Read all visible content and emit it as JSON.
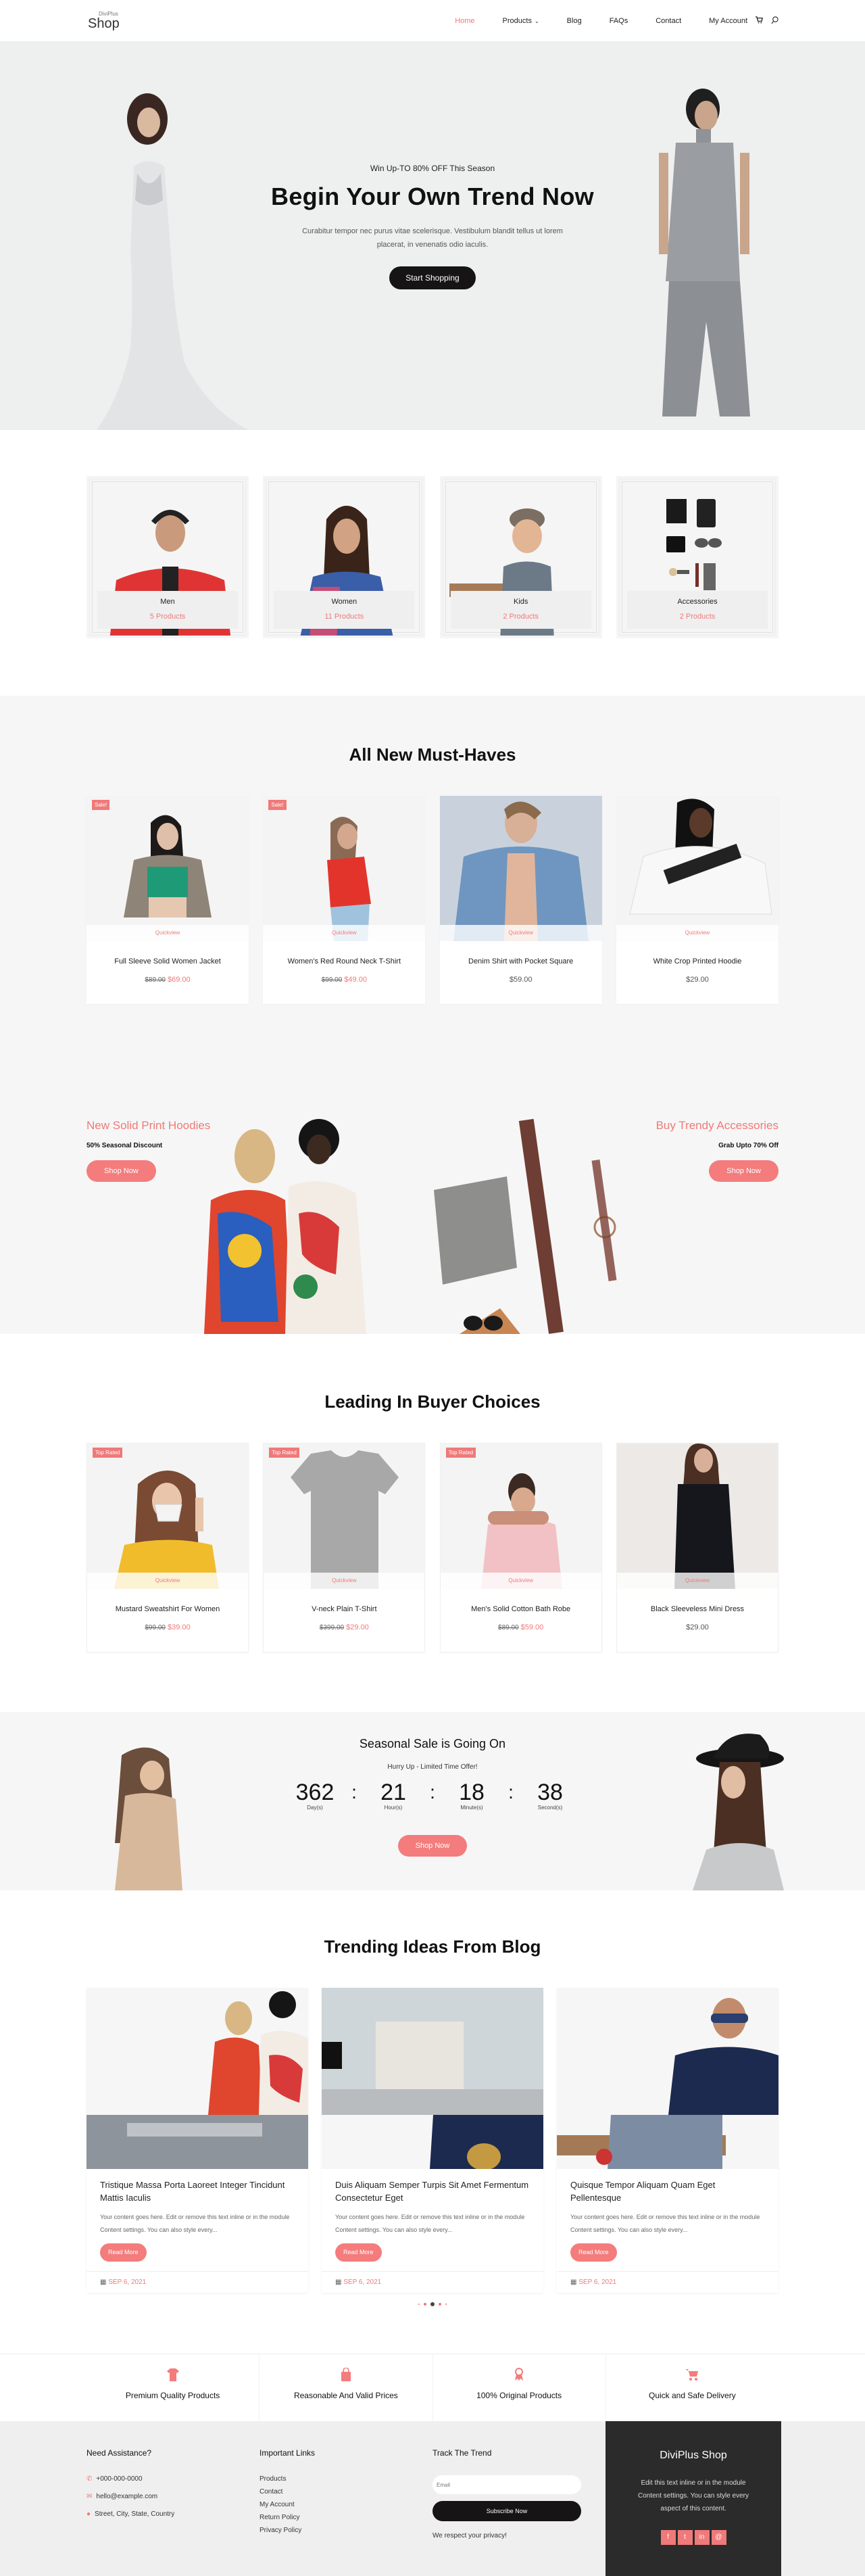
{
  "header": {
    "logo_small": "DiviPlus",
    "logo_big": "Shop",
    "nav": [
      {
        "label": "Home",
        "active": true
      },
      {
        "label": "Products",
        "has_dropdown": true
      },
      {
        "label": "Blog"
      },
      {
        "label": "FAQs"
      },
      {
        "label": "Contact"
      },
      {
        "label": "My Account"
      }
    ],
    "icons": [
      "cart-icon",
      "search-icon"
    ]
  },
  "hero": {
    "kicker": "Win Up-TO 80% OFF This Season",
    "title": "Begin Your Own Trend Now",
    "description": "Curabitur tempor nec purus vitae scelerisque. Vestibulum blandit tellus ut lorem placerat, in venenatis odio iaculis.",
    "cta": "Start Shopping"
  },
  "categories": [
    {
      "name": "Men",
      "count": "5 Products"
    },
    {
      "name": "Women",
      "count": "11 Products"
    },
    {
      "name": "Kids",
      "count": "2 Products"
    },
    {
      "name": "Accessories",
      "count": "2 Products"
    }
  ],
  "must_haves": {
    "title": "All New Must-Haves",
    "quickview_label": "Quickview",
    "products": [
      {
        "name": "Full Sleeve Solid Women Jacket",
        "old_price": "$89.00",
        "price": "$69.00",
        "badge": "Sale!"
      },
      {
        "name": "Women's Red Round Neck T-Shirt",
        "old_price": "$99.00",
        "price": "$49.00",
        "badge": "Sale!"
      },
      {
        "name": "Denim Shirt with Pocket Square",
        "price": "$59.00"
      },
      {
        "name": "White Crop Printed Hoodie",
        "price": "$29.00"
      }
    ]
  },
  "promo": {
    "left": {
      "title": "New Solid Print Hoodies",
      "subtitle": "50% Seasonal Discount",
      "cta": "Shop Now"
    },
    "right": {
      "title": "Buy Trendy Accessories",
      "subtitle": "Grab Upto 70% Off",
      "cta": "Shop Now"
    }
  },
  "leading": {
    "title": "Leading In Buyer Choices",
    "quickview_label": "Quickview",
    "products": [
      {
        "name": "Mustard Sweatshirt For Women",
        "old_price": "$99.00",
        "price": "$39.00",
        "badge": "Top Rated"
      },
      {
        "name": "V-neck Plain T-Shirt",
        "old_price": "$399.00",
        "price": "$29.00",
        "badge": "Top Rated"
      },
      {
        "name": "Men's Solid Cotton Bath Robe",
        "old_price": "$89.00",
        "price": "$59.00",
        "badge": "Top Rated"
      },
      {
        "name": "Black Sleeveless Mini Dress",
        "price": "$29.00"
      }
    ]
  },
  "countdown": {
    "title": "Seasonal Sale is Going On",
    "subtitle": "Hurry Up - Limited Time Offer!",
    "units": [
      {
        "value": "362",
        "label": "Day(s)"
      },
      {
        "value": "21",
        "label": "Hour(s)"
      },
      {
        "value": "18",
        "label": "Minute(s)"
      },
      {
        "value": "38",
        "label": "Second(s)"
      }
    ],
    "separator": ":",
    "cta": "Shop Now"
  },
  "blog": {
    "title": "Trending Ideas From Blog",
    "read_more": "Read More",
    "posts": [
      {
        "title": "Tristique Massa Porta Laoreet Integer Tincidunt Mattis Iaculis",
        "excerpt": "Your content goes here. Edit or remove this text inline or in the module Content settings. You can also style every...",
        "date": "SEP 6, 2021"
      },
      {
        "title": "Duis Aliquam Semper Turpis Sit Amet Fermentum Consectetur Eget",
        "excerpt": "Your content goes here. Edit or remove this text inline or in the module Content settings. You can also style every...",
        "date": "SEP 6, 2021"
      },
      {
        "title": "Quisque Tempor Aliquam Quam Eget Pellentesque",
        "excerpt": "Your content goes here. Edit or remove this text inline or in the module Content settings. You can also style every...",
        "date": "SEP 6, 2021"
      }
    ],
    "pagination": {
      "total_dots": 5,
      "active_index": 2
    }
  },
  "features": [
    {
      "icon": "tshirt-icon",
      "label": "Premium Quality Products"
    },
    {
      "icon": "shopping-bag-icon",
      "label": "Reasonable And Valid Prices"
    },
    {
      "icon": "award-ribbon-icon",
      "label": "100% Original Products"
    },
    {
      "icon": "cart-icon",
      "label": "Quick and Safe Delivery"
    }
  ],
  "footer": {
    "assistance": {
      "title": "Need Assistance?",
      "phone": "+000-000-0000",
      "email": "hello@example.com",
      "address": "Street, City, State, Country"
    },
    "links": {
      "title": "Important Links",
      "items": [
        "Products",
        "Contact",
        "My Account",
        "Return Policy",
        "Privacy Policy"
      ]
    },
    "newsletter": {
      "title": "Track The Trend",
      "placeholder": "Email",
      "button": "Subscribe Now",
      "note": "We respect your privacy!"
    },
    "brand": {
      "title": "DiviPlus Shop",
      "text": "Edit this text inline or in the module Content settings. You can style every aspect of this content.",
      "socials": [
        {
          "name": "facebook",
          "glyph": "f"
        },
        {
          "name": "twitter",
          "glyph": "t"
        },
        {
          "name": "linkedin",
          "glyph": "in"
        },
        {
          "name": "instagram",
          "glyph": "@"
        }
      ]
    }
  },
  "colors": {
    "accent": "#f07979",
    "dark": "#161414",
    "hero_bg": "#eeefef",
    "section_bg": "#f6f6f6",
    "footer_dark": "#2b2b2b"
  }
}
